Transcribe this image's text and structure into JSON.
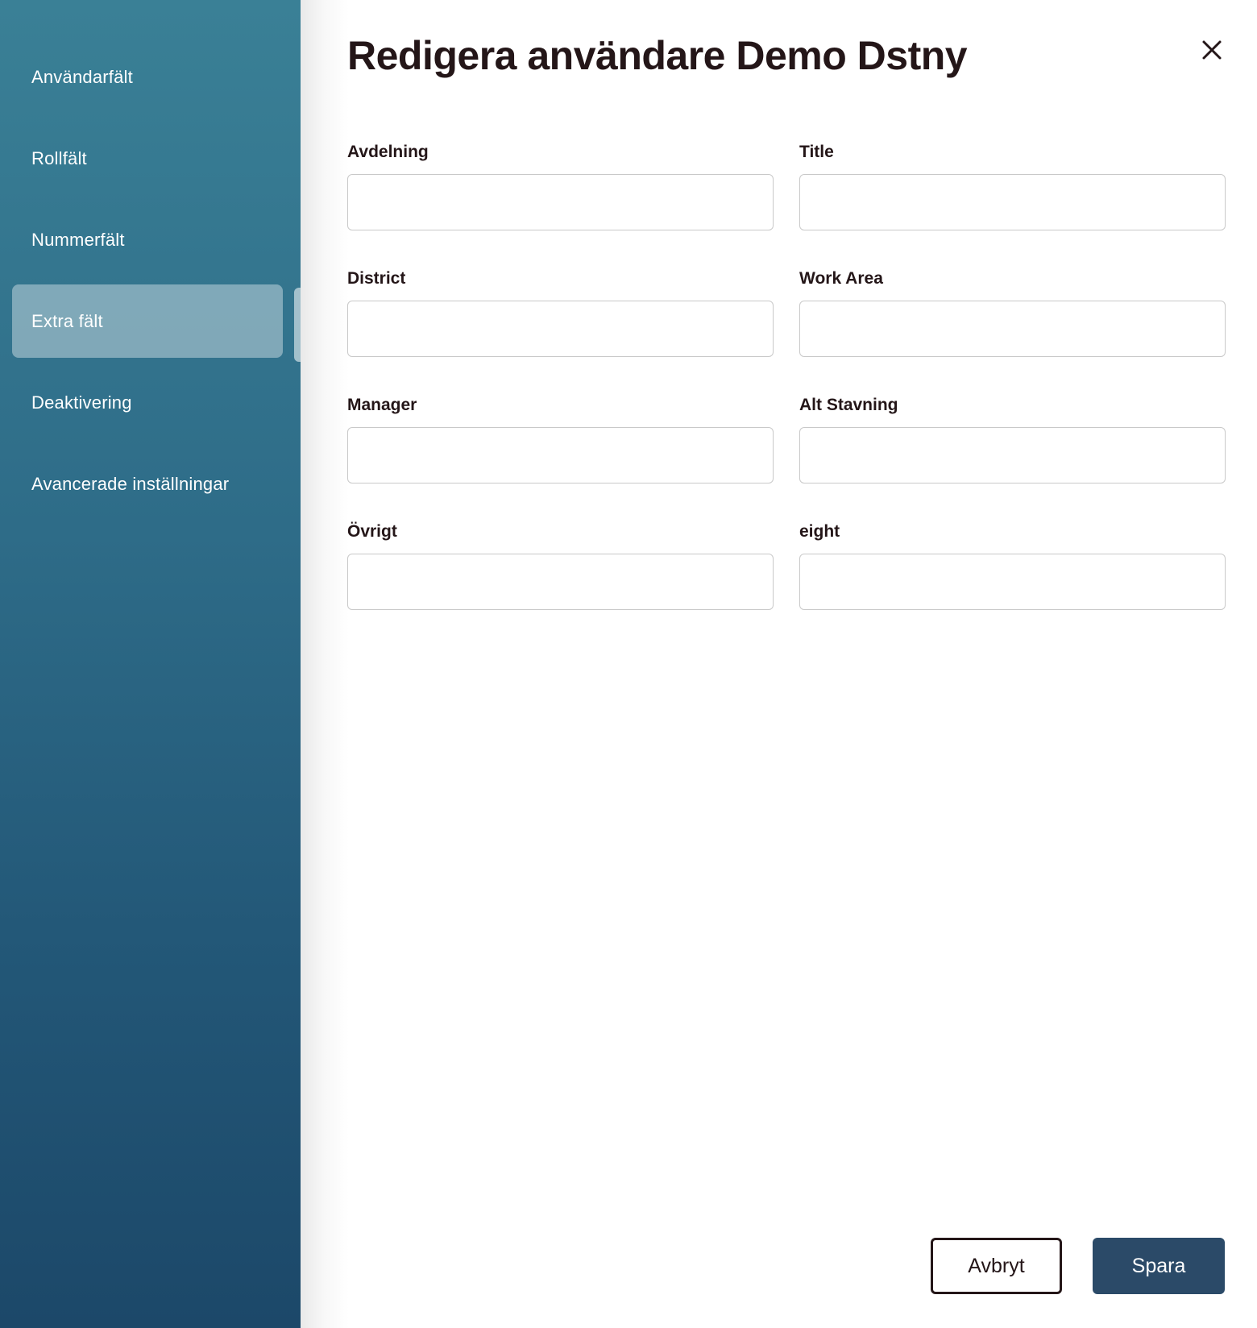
{
  "sidebar": {
    "items": [
      {
        "label": "Användarfält"
      },
      {
        "label": "Rollfält"
      },
      {
        "label": "Nummerfält"
      },
      {
        "label": "Extra fält"
      },
      {
        "label": "Deaktivering"
      },
      {
        "label": "Avancerade inställningar"
      }
    ],
    "active_item": "Extra fält"
  },
  "dialog": {
    "title": "Redigera användare Demo Dstny"
  },
  "form": {
    "fields": [
      {
        "label": "Avdelning",
        "value": ""
      },
      {
        "label": "Title",
        "value": ""
      },
      {
        "label": "District",
        "value": ""
      },
      {
        "label": "Work Area",
        "value": ""
      },
      {
        "label": "Manager",
        "value": ""
      },
      {
        "label": "Alt Stavning",
        "value": ""
      },
      {
        "label": "Övrigt",
        "value": ""
      },
      {
        "label": "eight",
        "value": ""
      }
    ]
  },
  "actions": {
    "cancel_label": "Avbryt",
    "save_label": "Spara"
  },
  "colors": {
    "sidebar_top": "#3a8096",
    "sidebar_bottom": "#1c4869",
    "primary_button": "#2b4a68",
    "text_dark": "#241618"
  },
  "icons": {
    "close": "close-icon"
  }
}
